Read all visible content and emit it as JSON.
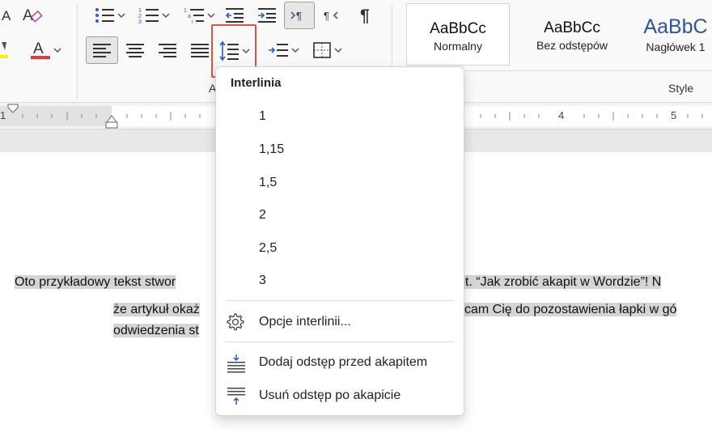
{
  "ribbon": {
    "paragraph_group_label": "Akapit",
    "styles_group_label": "Style",
    "styles": [
      {
        "preview": "AaBbCc",
        "name": "Normalny"
      },
      {
        "preview": "AaBbCc",
        "name": "Bez odstępów"
      },
      {
        "preview": "AaBbC",
        "name": "Nagłówek 1"
      }
    ],
    "accent_colors": {
      "highlight_box": "#e0533f",
      "font_color": "#e53935",
      "highlighter": "#f5f500",
      "heading_blue": "#2f5597"
    }
  },
  "ruler": {
    "numbers": [
      "1",
      "4",
      "5"
    ]
  },
  "document": {
    "line1_left": "Oto przykładowy tekst stwor",
    "line1_right": " pt. “Jak zrobić akapit w Wordzie”! N",
    "line2_left": "że artykuł okaż",
    "line2_right": "cam Cię do pozostawienia łapki w gó",
    "line3_left": "odwiedzenia st"
  },
  "menu": {
    "title": "Interlinia",
    "options": [
      "1",
      "1,15",
      "1,5",
      "2",
      "2,5",
      "3"
    ],
    "line_spacing_options_label": "Opcje interlinii...",
    "add_space_before_label": "Dodaj odstęp przed akapitem",
    "remove_space_after_label": "Usuń odstęp po akapicie"
  }
}
